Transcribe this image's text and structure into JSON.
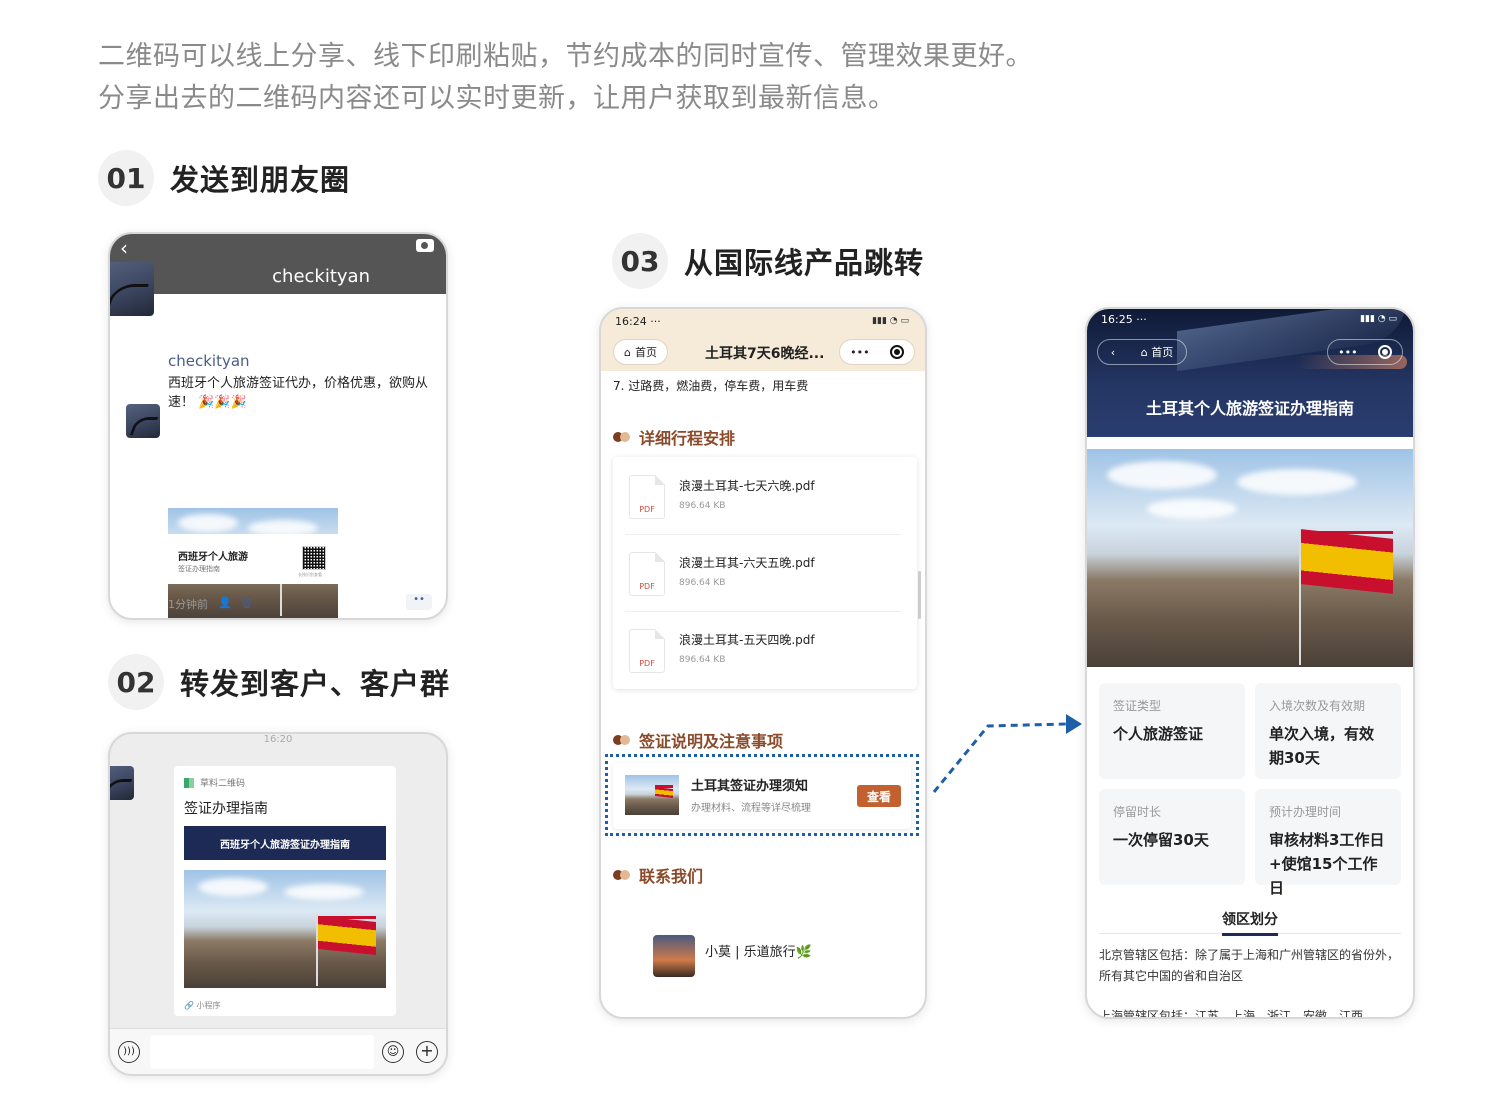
{
  "intro": {
    "line1": "二维码可以线上分享、线下印刷粘贴，节约成本的同时宣传、管理效果更好。",
    "line2": "分享出去的二维码内容还可以实时更新，让用户获取到最新信息。"
  },
  "sections": [
    {
      "num": "01",
      "title": "发送到朋友圈"
    },
    {
      "num": "02",
      "title": "转发到客户、客户群"
    },
    {
      "num": "03",
      "title": "从国际线产品跳转"
    }
  ],
  "moments": {
    "back_icon": "back-icon",
    "camera_icon": "camera-icon",
    "cover_name": "checkityan",
    "post_name": "checkityan",
    "post_text": "西班牙个人旅游签证代办，价格优惠，欲购从速！",
    "emoji": "🎉🎉🎉",
    "card_title": "西班牙个人旅游",
    "card_sub": "签证办理指南",
    "qr_caption": "长按识别查看",
    "time": "1分钟前",
    "more": "••"
  },
  "chat": {
    "time": "16:20",
    "source": "草料二维码",
    "title": "签证办理指南",
    "banner": "西班牙个人旅游签证办理指南",
    "footer": "小程序"
  },
  "phone3": {
    "time": "16:24",
    "status_dots": "···",
    "home": "首页",
    "title": "土耳其7天6晚经...",
    "more": "•••",
    "line7": "7. 过路费，燃油费，停车费，用车费",
    "sec1": "详细行程安排",
    "files": [
      {
        "name": "浪漫土耳其-七天六晚.pdf",
        "size": "896.64 KB",
        "type": "PDF"
      },
      {
        "name": "浪漫土耳其-六天五晚.pdf",
        "size": "896.64 KB",
        "type": "PDF"
      },
      {
        "name": "浪漫土耳其-五天四晚.pdf",
        "size": "896.64 KB",
        "type": "PDF"
      }
    ],
    "sec2": "签证说明及注意事项",
    "visa_title": "土耳其签证办理须知",
    "visa_sub": "办理材料、流程等详尽梳理",
    "visa_btn": "查看",
    "sec3": "联系我们",
    "contact": "小莫 | 乐道旅行🌿"
  },
  "phone4": {
    "time": "16:25",
    "status_dots": "···",
    "home": "首页",
    "more": "•••",
    "title": "土耳其个人旅游签证办理指南",
    "cards": [
      {
        "k": "签证类型",
        "v": "个人旅游签证"
      },
      {
        "k": "入境次数及有效期",
        "v": "单次入境，有效期30天"
      },
      {
        "k": "停留时长",
        "v": "一次停留30天"
      },
      {
        "k": "预计办理时间",
        "v": "审核材料3工作日+使馆15个工作日"
      }
    ],
    "tab": "领区划分",
    "para1": "北京管辖区包括：除了属于上海和广州管辖区的省份外，所有其它中国的省和自治区",
    "para2": "上海管辖区包括：江苏、上海、浙江、安徽、江西"
  },
  "colors": {
    "accent": "#c2612f",
    "brown": "#8b4a2a",
    "dashed": "#1f5fa8",
    "navy": "#1d2a55"
  }
}
